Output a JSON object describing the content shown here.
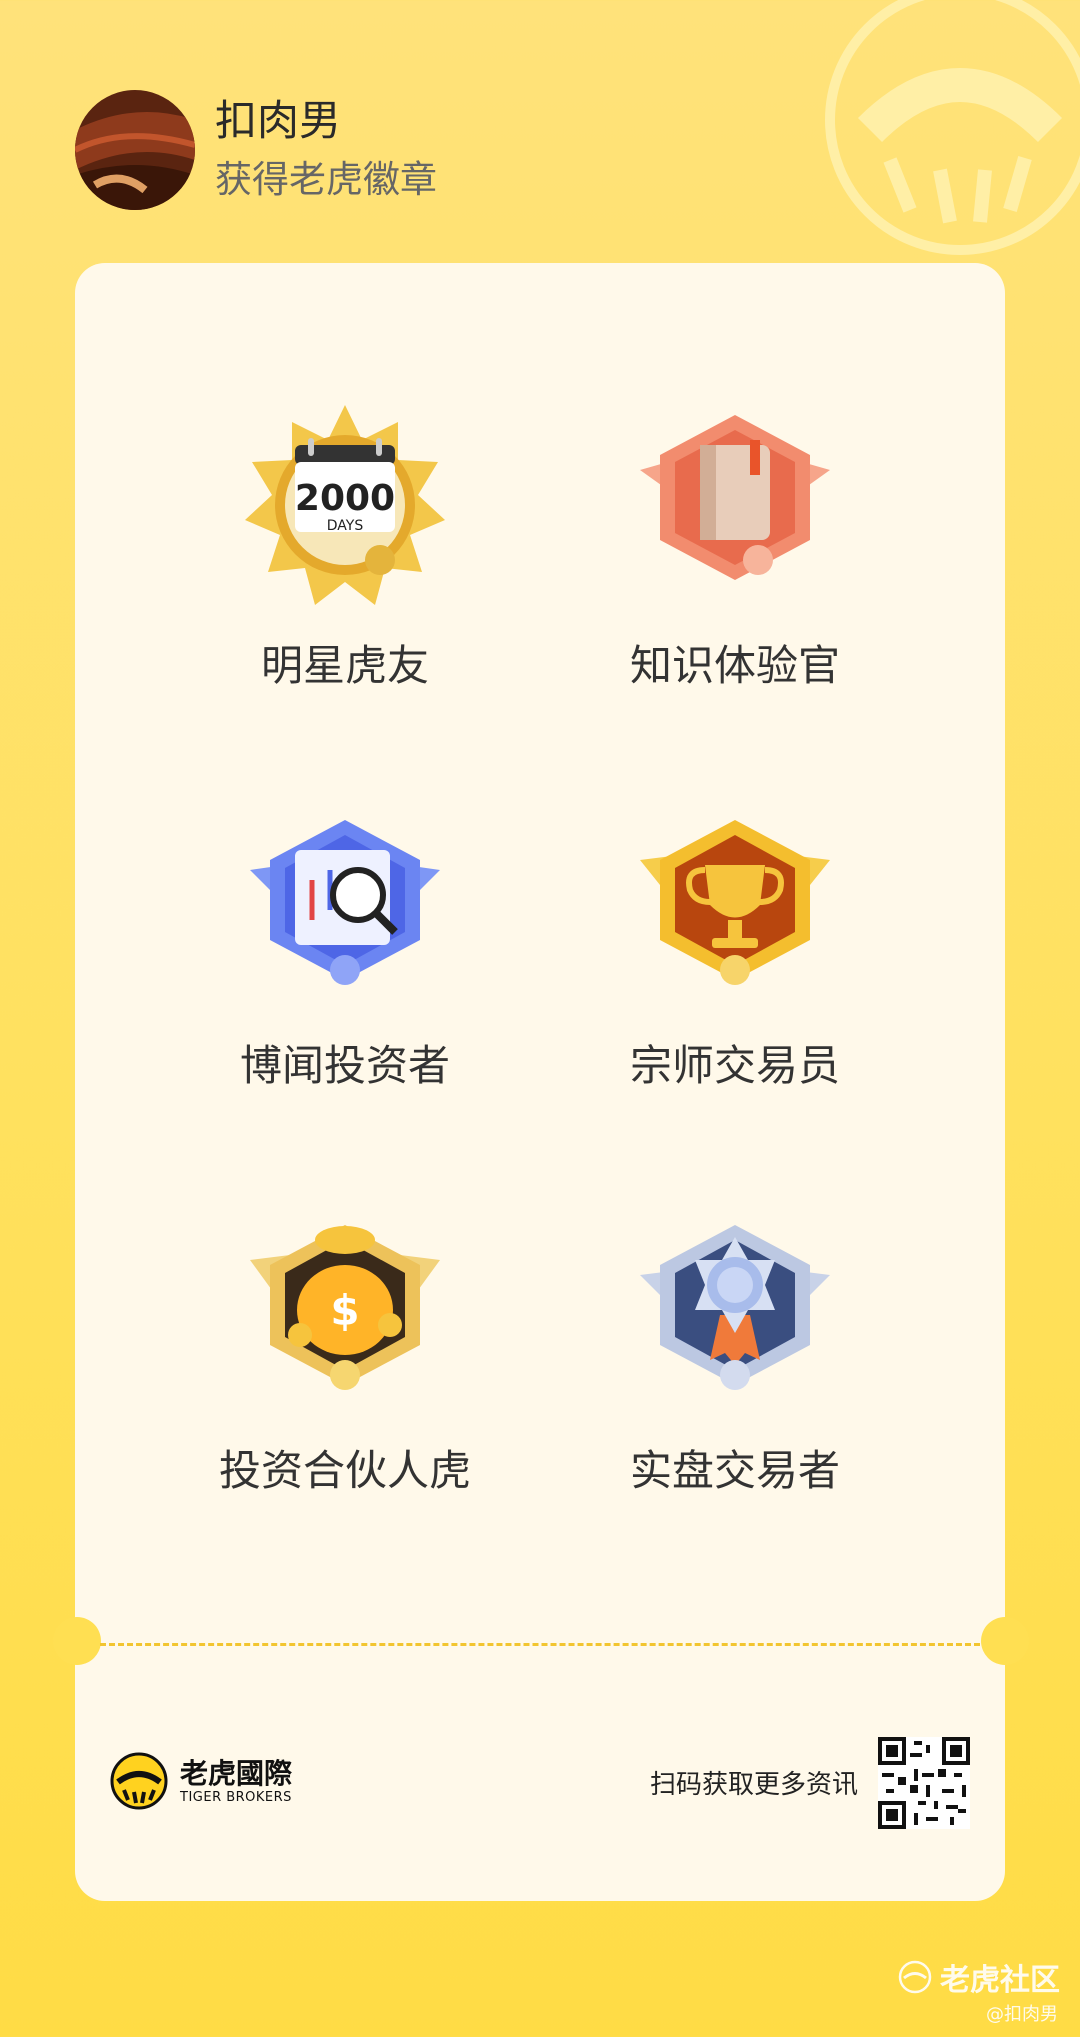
{
  "user": {
    "name": "扣肉男",
    "subtitle": "获得老虎徽章"
  },
  "badges": [
    {
      "name": "明星虎友",
      "icon": "sun-calendar-2000-days-badge",
      "emblem_text": "2000",
      "emblem_sub": "DAYS"
    },
    {
      "name": "知识体验官",
      "icon": "book-badge"
    },
    {
      "name": "博闻投资者",
      "icon": "magnifier-chart-badge"
    },
    {
      "name": "宗师交易员",
      "icon": "trophy-badge"
    },
    {
      "name": "投资合伙人虎",
      "icon": "money-bag-tiger-badge"
    },
    {
      "name": "实盘交易者",
      "icon": "silver-medal-badge"
    }
  ],
  "footer": {
    "brand_cn": "老虎國際",
    "brand_en": "TIGER BROKERS",
    "scan_text": "扫码获取更多资讯"
  },
  "watermark": {
    "title": "老虎社区",
    "handle": "@扣肉男"
  },
  "colors": {
    "background": "#FFE15E",
    "card": "#FFF9EA",
    "dash": "#F2C530"
  }
}
